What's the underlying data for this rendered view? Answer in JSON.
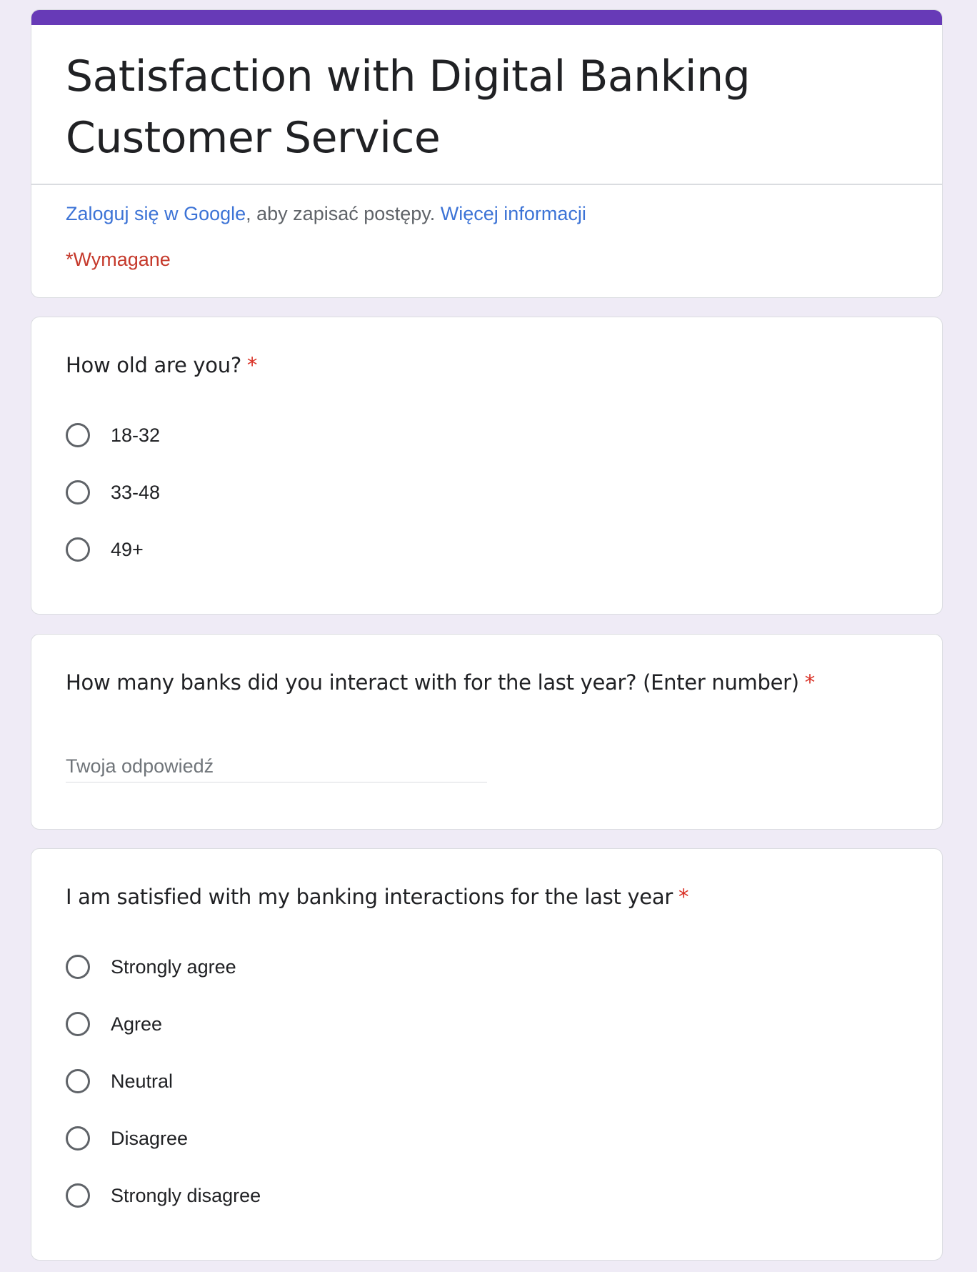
{
  "form": {
    "title": "Satisfaction with Digital Banking Customer Service",
    "accent_color": "#673ab7",
    "signin": {
      "link_text": "Zaloguj się w Google",
      "middle_text": ", aby zapisać postępy. ",
      "more_link": "Więcej informacji"
    },
    "required_note": "*Wymagane"
  },
  "questions": [
    {
      "title": "How old are you?",
      "required_mark": "*",
      "type": "radio",
      "options": [
        "18-32",
        "33-48",
        "49+"
      ]
    },
    {
      "title": "How many banks did you interact with for the last year? (Enter number)",
      "required_mark": "*",
      "type": "text",
      "placeholder": "Twoja odpowiedź"
    },
    {
      "title": "I am satisfied with my banking interactions for the last year",
      "required_mark": "*",
      "type": "radio",
      "options": [
        "Strongly agree",
        "Agree",
        "Neutral",
        "Disagree",
        "Strongly disagree"
      ]
    }
  ]
}
